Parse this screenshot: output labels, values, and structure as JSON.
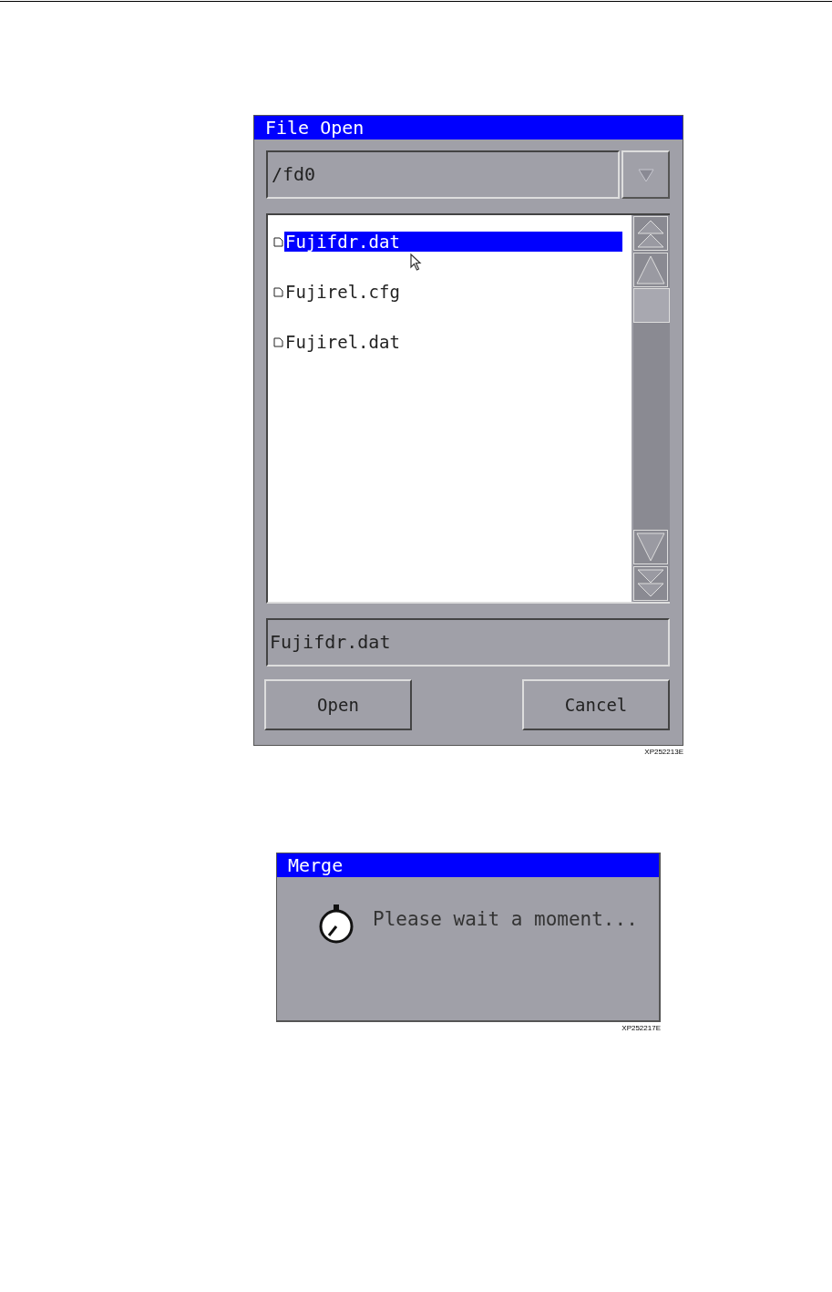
{
  "file_open": {
    "title": "File Open",
    "path": "/fd0",
    "files": [
      {
        "name": "Fujifdr.dat",
        "selected": true
      },
      {
        "name": "Fujirel.cfg",
        "selected": false
      },
      {
        "name": "Fujirel.dat",
        "selected": false
      }
    ],
    "file_name": "Fujifdr.dat",
    "buttons": [
      "Open",
      "Cancel"
    ],
    "figure_code": "XP252213E"
  },
  "merge": {
    "title": "Merge",
    "message": "Please wait a moment...",
    "figure_code": "XP252217E"
  }
}
